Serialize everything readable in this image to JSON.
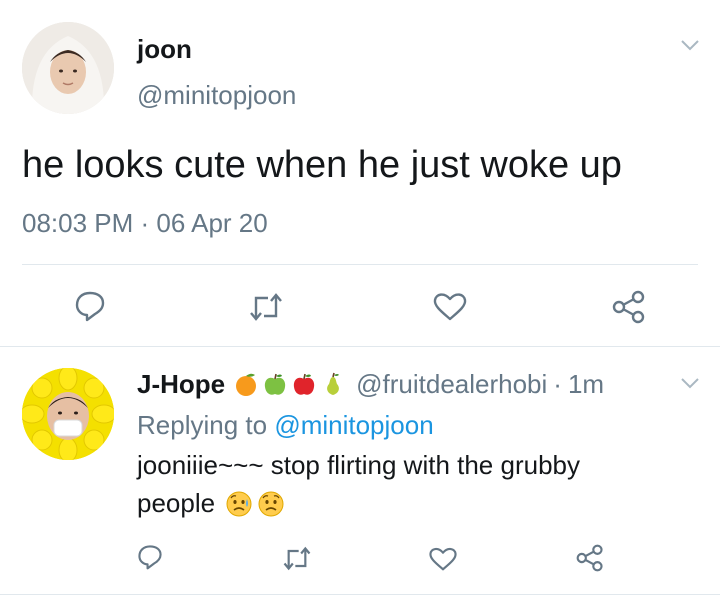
{
  "main_tweet": {
    "author_name": "joon",
    "handle": "@minitopjoon",
    "text": "he looks cute when he just woke up",
    "timestamp": "08:03 PM · 06 Apr 20"
  },
  "reply": {
    "author_name": "J-Hope",
    "name_emojis": [
      "orange",
      "green apple",
      "red apple",
      "pear"
    ],
    "handle": "@fruitdealerhobi",
    "separator": "·",
    "age": "1m",
    "replying_to_label": "Replying to",
    "replying_to_handle": "@minitopjoon",
    "text_line1": "jooniiie~~~ stop flirting with the grubby",
    "text_line2": "people",
    "text_emojis": [
      "sad-but-relieved-face",
      "sad-face"
    ]
  },
  "icons": {
    "reply": "reply-icon",
    "retweet": "retweet-icon",
    "like": "heart-icon",
    "share": "share-icon",
    "menu": "chevron-down-icon"
  },
  "colors": {
    "text": "#14171a",
    "muted": "#657786",
    "link": "#1b95e0",
    "divider": "#e1e8ed"
  }
}
